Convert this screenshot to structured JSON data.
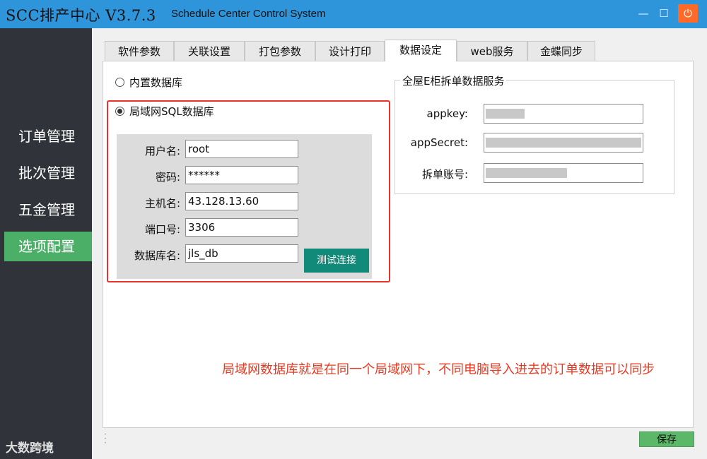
{
  "window": {
    "title": "SCC排产中心 V3.7.3",
    "subtitle": "Schedule Center Control System",
    "minimize": "—",
    "maximize": "☐",
    "close": "⏻"
  },
  "sidebar": {
    "items": [
      {
        "label": "订单管理"
      },
      {
        "label": "批次管理"
      },
      {
        "label": "五金管理"
      },
      {
        "label": "选项配置",
        "active": true
      }
    ],
    "watermark": "大数跨境"
  },
  "tabs": [
    {
      "label": "软件参数"
    },
    {
      "label": "关联设置"
    },
    {
      "label": "打包参数"
    },
    {
      "label": "设计打印"
    },
    {
      "label": "数据设定",
      "active": true
    },
    {
      "label": "web服务"
    },
    {
      "label": "金蝶同步"
    }
  ],
  "db": {
    "builtin_label": "内置数据库",
    "lan_label": "局域网SQL数据库",
    "selected": "lan",
    "fields": [
      {
        "label": "用户名:",
        "value": "root"
      },
      {
        "label": "密码:",
        "value": "******"
      },
      {
        "label": "主机名:",
        "value": "43.128.13.60"
      },
      {
        "label": "端口号:",
        "value": "3306"
      },
      {
        "label": "数据库名:",
        "value": "jls_db"
      }
    ],
    "test_button": "测试连接"
  },
  "service": {
    "title": "全屋E柜拆单数据服务",
    "fields": [
      {
        "label": "appkey:"
      },
      {
        "label": "appSecret:"
      },
      {
        "label": "拆单账号:"
      }
    ]
  },
  "annotation": "局域网数据库就是在同一个局域网下，不同电脑导入进去的订单数据可以同步",
  "footer": {
    "save_button": "保存"
  },
  "colors": {
    "titlebar": "#2e95db",
    "sidebar": "#30343a",
    "active_nav": "#4caf68",
    "test_button": "#128a7a",
    "highlight_box": "#e8342c",
    "annotation": "#e63a22",
    "save_button": "#5ab868"
  }
}
